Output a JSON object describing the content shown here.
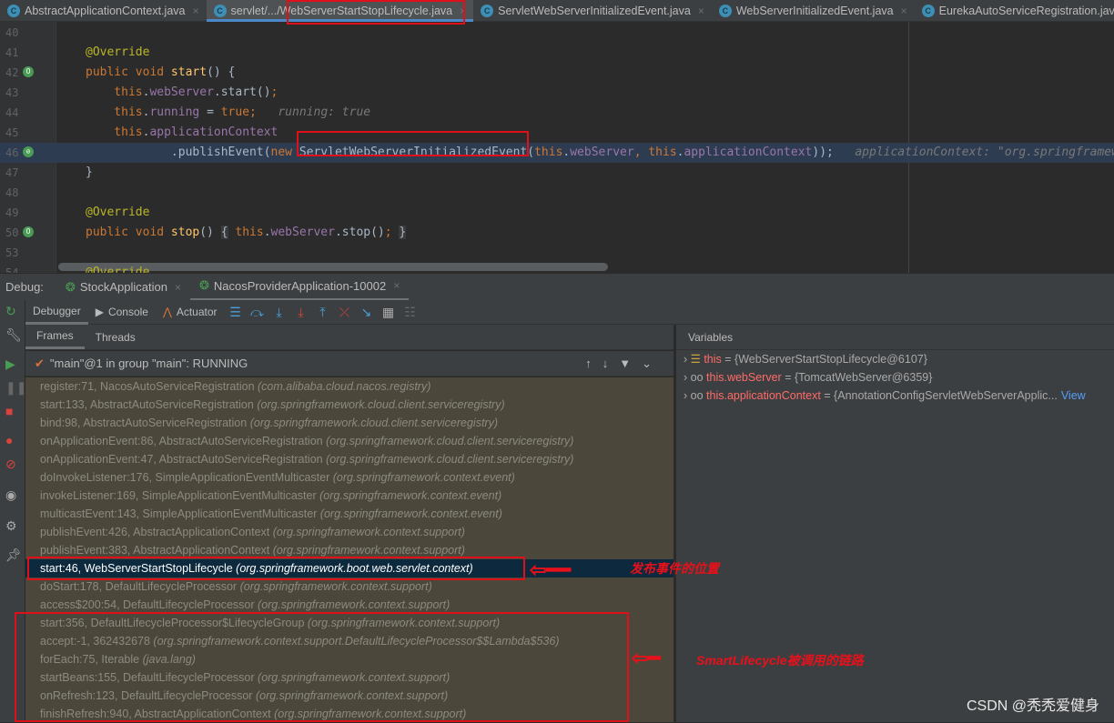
{
  "tabs": [
    {
      "label": "AbstractApplicationContext.java",
      "active": false
    },
    {
      "label": "servlet/.../WebServerStartStopLifecycle.java",
      "active": true
    },
    {
      "label": "ServletWebServerInitializedEvent.java",
      "active": false
    },
    {
      "label": "WebServerInitializedEvent.java",
      "active": false
    },
    {
      "label": "EurekaAutoServiceRegistration.java",
      "active": false
    }
  ],
  "code": [
    {
      "n": "40",
      "t": []
    },
    {
      "n": "41",
      "t": [
        [
          "@Override",
          "ann"
        ]
      ]
    },
    {
      "n": "42",
      "icon": "override-icon",
      "t": [
        [
          "public void ",
          "kw"
        ],
        [
          "start",
          "fn"
        ],
        [
          "() {",
          "txt"
        ]
      ]
    },
    {
      "n": "43",
      "t": [
        [
          "    this",
          "kw"
        ],
        [
          ".",
          "txt"
        ],
        [
          "webServer",
          "fld"
        ],
        [
          ".start()",
          "txt"
        ],
        [
          ";",
          "kw"
        ]
      ]
    },
    {
      "n": "44",
      "t": [
        [
          "    this",
          "kw"
        ],
        [
          ".",
          "txt"
        ],
        [
          "running",
          "fld"
        ],
        [
          " = ",
          "txt"
        ],
        [
          "true;",
          "kw"
        ],
        [
          "   running: true",
          "hint"
        ]
      ]
    },
    {
      "n": "45",
      "t": [
        [
          "    this",
          "kw"
        ],
        [
          ".",
          "txt"
        ],
        [
          "applicationContext",
          "fld"
        ]
      ]
    },
    {
      "n": "46",
      "icon": "breakpoint-icon",
      "hl": true,
      "t": [
        [
          "            .publishEvent(",
          "txt"
        ],
        [
          "new ",
          "kw"
        ],
        [
          "ServletWebServerInitializedEvent",
          "txt"
        ],
        [
          "(",
          "txt"
        ],
        [
          "this",
          "kw"
        ],
        [
          ".",
          "txt"
        ],
        [
          "webServer",
          "fld"
        ],
        [
          ", ",
          "kw"
        ],
        [
          "this",
          "kw"
        ],
        [
          ".",
          "txt"
        ],
        [
          "applicationContext",
          "fld"
        ],
        [
          "));",
          "txt"
        ],
        [
          "   applicationContext: \"org.springframework",
          "hint"
        ]
      ]
    },
    {
      "n": "47",
      "t": [
        [
          "}",
          "txt"
        ]
      ]
    },
    {
      "n": "48",
      "t": []
    },
    {
      "n": "49",
      "t": [
        [
          "@Override",
          "ann"
        ]
      ]
    },
    {
      "n": "50",
      "icon": "override-icon",
      "t": [
        [
          "public void ",
          "kw"
        ],
        [
          "stop",
          "fn"
        ],
        [
          "() ",
          "txt"
        ],
        [
          "{",
          "brace"
        ],
        [
          " this",
          "kw"
        ],
        [
          ".",
          "txt"
        ],
        [
          "webServer",
          "fld"
        ],
        [
          ".stop()",
          "txt"
        ],
        [
          ";",
          "kw"
        ],
        [
          " ",
          "txt"
        ],
        [
          "}",
          "brace"
        ]
      ]
    },
    {
      "n": "53",
      "t": []
    },
    {
      "n": "54",
      "t": [
        [
          "@Override",
          "ann"
        ]
      ]
    }
  ],
  "debug": {
    "label": "Debug:",
    "sessions": [
      {
        "label": "StockApplication",
        "active": false
      },
      {
        "label": "NacosProviderApplication-10002",
        "active": true
      }
    ]
  },
  "toolbar": {
    "debugger": "Debugger",
    "console": "Console",
    "actuator": "Actuator"
  },
  "subtabs": {
    "frames": "Frames",
    "threads": "Threads"
  },
  "thread": "\"main\"@1 in group \"main\": RUNNING",
  "frames": [
    {
      "m": "register:71, NacosAutoServiceRegistration",
      "p": "(com.alibaba.cloud.nacos.registry)"
    },
    {
      "m": "start:133, AbstractAutoServiceRegistration",
      "p": "(org.springframework.cloud.client.serviceregistry)"
    },
    {
      "m": "bind:98, AbstractAutoServiceRegistration",
      "p": "(org.springframework.cloud.client.serviceregistry)"
    },
    {
      "m": "onApplicationEvent:86, AbstractAutoServiceRegistration",
      "p": "(org.springframework.cloud.client.serviceregistry)"
    },
    {
      "m": "onApplicationEvent:47, AbstractAutoServiceRegistration",
      "p": "(org.springframework.cloud.client.serviceregistry)"
    },
    {
      "m": "doInvokeListener:176, SimpleApplicationEventMulticaster",
      "p": "(org.springframework.context.event)"
    },
    {
      "m": "invokeListener:169, SimpleApplicationEventMulticaster",
      "p": "(org.springframework.context.event)"
    },
    {
      "m": "multicastEvent:143, SimpleApplicationEventMulticaster",
      "p": "(org.springframework.context.event)"
    },
    {
      "m": "publishEvent:426, AbstractApplicationContext",
      "p": "(org.springframework.context.support)"
    },
    {
      "m": "publishEvent:383, AbstractApplicationContext",
      "p": "(org.springframework.context.support)"
    },
    {
      "m": "start:46, WebServerStartStopLifecycle",
      "p": "(org.springframework.boot.web.servlet.context)",
      "sel": true
    },
    {
      "m": "doStart:178, DefaultLifecycleProcessor",
      "p": "(org.springframework.context.support)"
    },
    {
      "m": "access$200:54, DefaultLifecycleProcessor",
      "p": "(org.springframework.context.support)"
    },
    {
      "m": "start:356, DefaultLifecycleProcessor$LifecycleGroup",
      "p": "(org.springframework.context.support)"
    },
    {
      "m": "accept:-1, 362432678",
      "p": "(org.springframework.context.support.DefaultLifecycleProcessor$$Lambda$536)"
    },
    {
      "m": "forEach:75, Iterable",
      "p": "(java.lang)"
    },
    {
      "m": "startBeans:155, DefaultLifecycleProcessor",
      "p": "(org.springframework.context.support)"
    },
    {
      "m": "onRefresh:123, DefaultLifecycleProcessor",
      "p": "(org.springframework.context.support)"
    },
    {
      "m": "finishRefresh:940, AbstractApplicationContext",
      "p": "(org.springframework.context.support)"
    }
  ],
  "variables": {
    "title": "Variables",
    "items": [
      {
        "icon": "field-icon",
        "name": "this",
        "value": " = {WebServerStartStopLifecycle@6107}"
      },
      {
        "icon": "watch-icon",
        "name": "this.webServer",
        "value": " = {TomcatWebServer@6359}"
      },
      {
        "icon": "watch-icon",
        "name": "this.applicationContext",
        "value": " = {AnnotationConfigServletWebServerApplic...",
        "link": "View"
      }
    ]
  },
  "annotations": {
    "publish": "发布事件的位置",
    "chain": "SmartLifecycle被调用的链路"
  },
  "watermark": "CSDN @秃秃爱健身",
  "colors": {
    "accent": "#4a88c7",
    "annotation": "#e0101a",
    "selected_frame": "#0d293e"
  }
}
